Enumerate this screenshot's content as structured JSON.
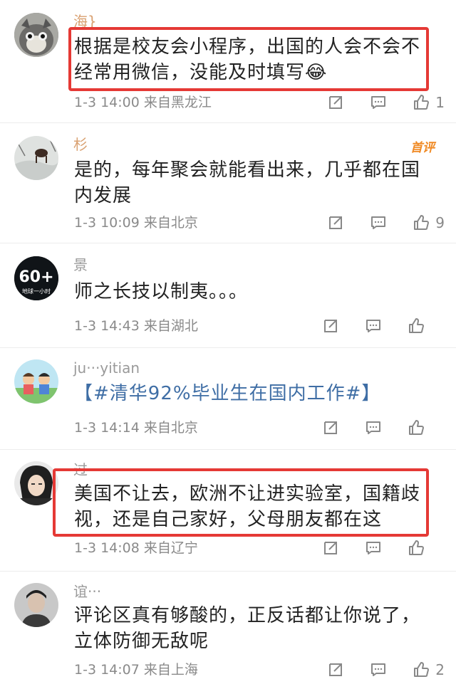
{
  "comments": [
    {
      "username": "海}",
      "text": "根据是校友会小程序，出国的人会不会不经常用微信，没能及时填写😂",
      "time": "1-3 14:00",
      "location": "来自黑龙江",
      "likes": "1"
    },
    {
      "username": "杉",
      "badge": "首评",
      "text": "是的，每年聚会就能看出来，几乎都在国内发展",
      "time": "1-3 10:09",
      "location": "来自北京",
      "likes": "9"
    },
    {
      "username": "景",
      "avatar_text": "60+",
      "avatar_sub": "地球一小时",
      "text": "师之长技以制夷。。。",
      "time": "1-3 14:43",
      "location": "来自湖北",
      "likes": ""
    },
    {
      "username": "ju···yitian",
      "text": "【#清华92%毕业生在国内工作#】",
      "time": "1-3 14:14",
      "location": "来自北京",
      "likes": ""
    },
    {
      "username": "过···",
      "text": "美国不让去，欧洲不让进实验室，国籍歧视，还是自己家好，父母朋友都在这",
      "time": "1-3 14:08",
      "location": "来自辽宁",
      "likes": ""
    },
    {
      "username": "谊···",
      "text": "评论区真有够酸的，正反话都让你说了，立体防御无敌呢",
      "time": "1-3 14:07",
      "location": "来自上海",
      "likes": "2"
    }
  ],
  "icons": {
    "repost": "share-icon",
    "reply": "comment-icon",
    "like": "thumbs-up-icon"
  },
  "colors": {
    "highlight": "#e53935",
    "hashtag": "#3f6ea5",
    "badge": "#f08a24",
    "meta": "#8a8a8a"
  }
}
